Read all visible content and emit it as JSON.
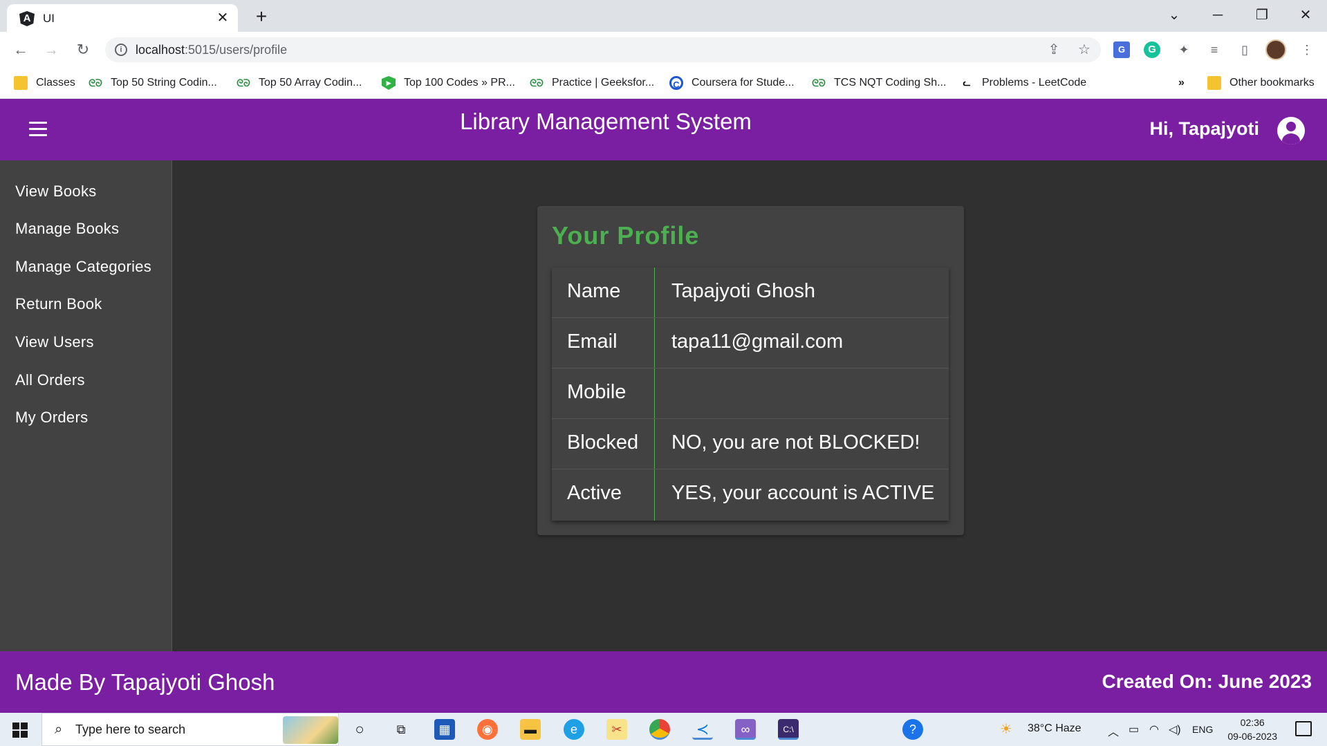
{
  "browser": {
    "tab_title": "UI",
    "url_host": "localhost",
    "url_path": ":5015/users/profile",
    "bookmarks": [
      {
        "label": "Classes",
        "icon": "folder-icon"
      },
      {
        "label": "Top 50 String Codin...",
        "icon": "gfg-icon"
      },
      {
        "label": "Top 50 Array Codin...",
        "icon": "gfg-icon"
      },
      {
        "label": "Top 100 Codes » PR...",
        "icon": "shield-icon"
      },
      {
        "label": "Practice | Geeksfor...",
        "icon": "gfg-icon"
      },
      {
        "label": "Coursera for Stude...",
        "icon": "coursera-icon"
      },
      {
        "label": "TCS NQT Coding Sh...",
        "icon": "gfg-icon"
      },
      {
        "label": "Problems - LeetCode",
        "icon": "leetcode-icon"
      }
    ],
    "other_bookmarks": "Other bookmarks",
    "overflow": "»"
  },
  "header": {
    "title": "Library Management System",
    "greeting": "Hi, Tapajyoti"
  },
  "sidebar": {
    "items": [
      {
        "label": "View Books"
      },
      {
        "label": "Manage Books"
      },
      {
        "label": "Manage Categories"
      },
      {
        "label": "Return Book"
      },
      {
        "label": "View Users"
      },
      {
        "label": "All Orders"
      },
      {
        "label": "My Orders"
      }
    ]
  },
  "profile": {
    "title": "Your Profile",
    "rows": [
      {
        "key": "Name",
        "value": "Tapajyoti Ghosh"
      },
      {
        "key": "Email",
        "value": "tapa11@gmail.com"
      },
      {
        "key": "Mobile",
        "value": ""
      },
      {
        "key": "Blocked",
        "value": "NO, you are not BLOCKED!"
      },
      {
        "key": "Active",
        "value": "YES, your account is ACTIVE"
      }
    ]
  },
  "footer": {
    "left": "Made By Tapajyoti Ghosh",
    "right": "Created On: June 2023"
  },
  "taskbar": {
    "search_placeholder": "Type here to search",
    "weather": "38°C  Haze",
    "language": "ENG",
    "time": "02:36",
    "date": "09-06-2023"
  },
  "colors": {
    "primary": "#7b1fa2",
    "accent_green": "#4caf50",
    "background": "#303030",
    "sidebar": "#424242"
  }
}
